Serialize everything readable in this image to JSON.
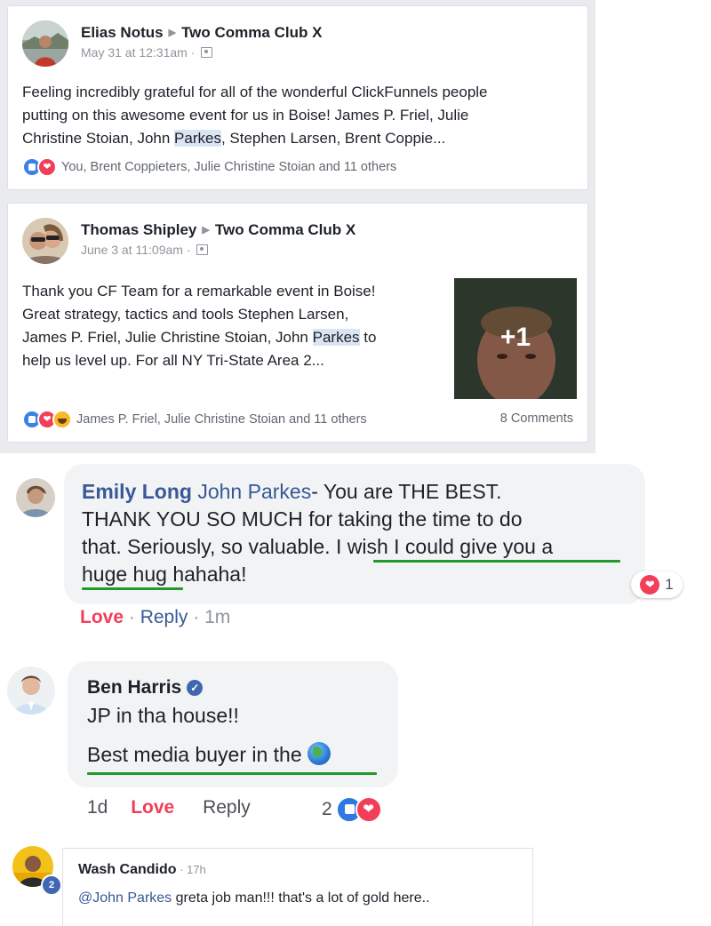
{
  "posts": [
    {
      "author": "Elias Notus",
      "group": "Two Comma Club X",
      "timestamp": "May 31 at 12:31am",
      "text_lines": [
        "Feeling incredibly grateful for all of the wonderful ClickFunnels people",
        "putting on this awesome event for us in Boise! James P. Friel, Julie"
      ],
      "text_line3_before": "Christine Stoian, John ",
      "text_line3_highlight": "Parkes",
      "text_line3_after": ", Stephen Larsen, Brent Coppie...",
      "reactions_summary": "You, Brent Coppieters, Julie Christine Stoian and 11 others"
    },
    {
      "author": "Thomas Shipley",
      "group": "Two Comma Club X",
      "timestamp": "June 3 at 11:09am",
      "text_lines": [
        "Thank you CF Team for a remarkable event in Boise!",
        "Great strategy, tactics and tools Stephen Larsen,"
      ],
      "text_line3_before": "James P. Friel, Julie Christine Stoian, John ",
      "text_line3_highlight": "Parkes",
      "text_line3_after": " to",
      "text_line4": "help us level up. For all NY Tri-State Area 2...",
      "photo_overlay": "+1",
      "reactions_summary": "James P. Friel, Julie Christine Stoian and 11 others",
      "comments_count": "8 Comments"
    }
  ],
  "comments": {
    "emily": {
      "author": "Emily Long",
      "mention": "John Parkes",
      "line1_rest": "- You are THE BEST.",
      "line2": "THANK YOU SO MUCH for taking the time to do",
      "line3": "that. Seriously, so valuable. I wish I could give you a",
      "line4": "huge hug hahaha!",
      "reaction_count": "1",
      "love_label": "Love",
      "sep": " · ",
      "reply_label": "Reply",
      "time": "1m"
    },
    "ben": {
      "author": "Ben Harris",
      "line1": "JP in tha house!!",
      "line2": "Best media buyer in the",
      "time": "1d",
      "love_label": "Love",
      "reply_label": "Reply",
      "reaction_count": "2"
    },
    "wash": {
      "author": "Wash Candido",
      "time": " · 17h",
      "mention": "@John Parkes",
      "text": " greta job man!!! that's a lot of gold here..",
      "avatar_badge": "2"
    }
  },
  "icons": [
    "like-icon",
    "love-icon",
    "haha-icon",
    "audience-icon",
    "verified-icon",
    "globe-icon"
  ],
  "colors": {
    "link": "#385898",
    "love": "#f33e58",
    "like": "#3b82e6",
    "underline": "#1f9a2b",
    "feed_bg": "#e9ebee",
    "bubble": "#f2f3f5"
  }
}
